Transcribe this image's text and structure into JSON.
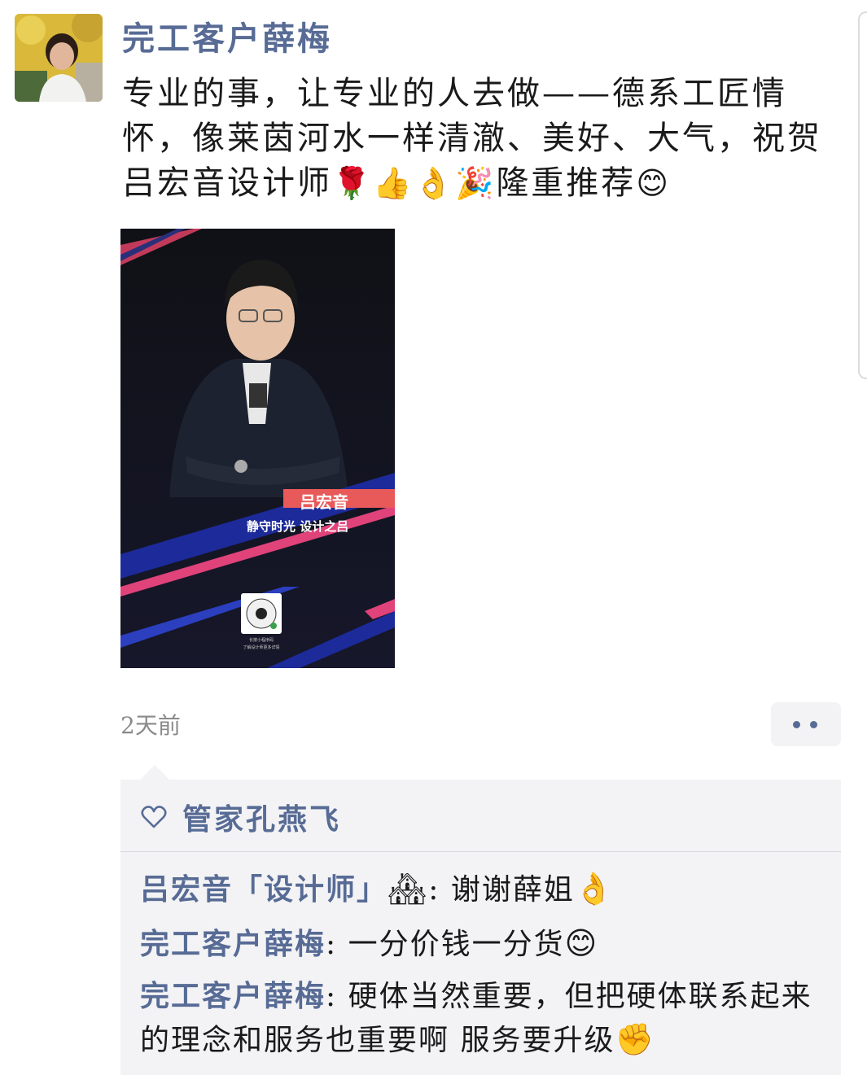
{
  "post": {
    "author": "完工客户薛梅",
    "text": "专业的事，让专业的人去做——德系工匠情怀，像莱茵河水一样清澈、美好、大气，祝贺吕宏音设计师",
    "text_tail": "隆重推荐",
    "emoji_sequence": [
      "🌹",
      "👍",
      "👌",
      "🎉"
    ],
    "emoji_end": "😊",
    "photo": {
      "name": "吕宏音",
      "slogan": "静守时光 设计之吕",
      "caption_line1": "长按小程序码",
      "caption_line2": "了解设计师更多详情"
    },
    "timestamp": "2天前"
  },
  "likes": {
    "names": "管家孔燕飞"
  },
  "comments": [
    {
      "author": "吕宏音「设计师」",
      "author_emoji": "🏘",
      "sep": ": ",
      "text": "谢谢薛姐",
      "emoji": "👌"
    },
    {
      "author": "完工客户薛梅",
      "sep": ": ",
      "text": "一分价钱一分货",
      "emoji": "😊"
    },
    {
      "author": "完工客户薛梅",
      "sep": ": ",
      "text": "硬体当然重要，但把硬体联系起来的理念和服务也重要啊 服务要升级",
      "emoji": "✊"
    }
  ],
  "icons": {
    "heart": "heart-icon",
    "more": "more-dots-icon",
    "accent_color": "#576b95",
    "comment_bg": "#f3f3f5"
  }
}
